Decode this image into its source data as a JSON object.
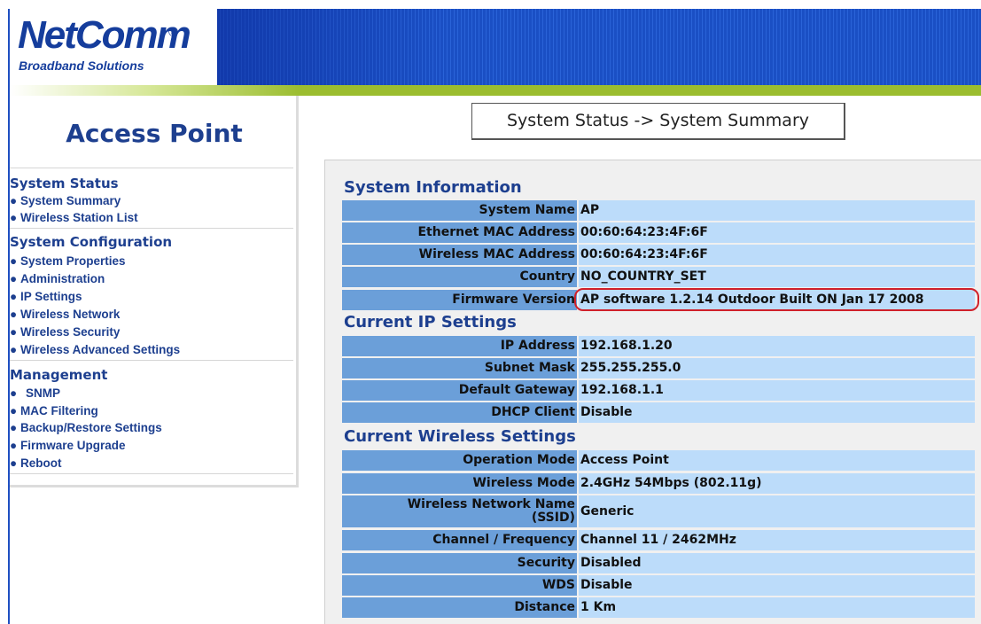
{
  "brand": {
    "logo": "NetComm",
    "registered": "®",
    "tagline": "Broadband Solutions"
  },
  "sidebar": {
    "title": "Access Point",
    "sections": [
      {
        "heading": "System Status",
        "items": [
          "System Summary",
          "Wireless Station List"
        ]
      },
      {
        "heading": "System Configuration",
        "items": [
          "System Properties",
          "Administration",
          "IP Settings",
          "Wireless Network",
          "Wireless Security",
          "Wireless Advanced Settings"
        ]
      },
      {
        "heading": "Management",
        "items": [
          "SNMP",
          "MAC Filtering",
          "Backup/Restore Settings",
          "Firmware Upgrade",
          "Reboot"
        ]
      }
    ],
    "bullet": "●"
  },
  "main": {
    "page_heading": "System Status -> System Summary",
    "system_information": {
      "title": "System Information",
      "rows": [
        {
          "label": "System Name",
          "value": "AP"
        },
        {
          "label": "Ethernet MAC Address",
          "value": "00:60:64:23:4F:6F"
        },
        {
          "label": "Wireless MAC Address",
          "value": "00:60:64:23:4F:6F"
        },
        {
          "label": "Country",
          "value": "NO_COUNTRY_SET"
        },
        {
          "label": "Firmware Version",
          "value": "AP software 1.2.14 Outdoor Built ON Jan 17 2008"
        }
      ]
    },
    "ip_settings": {
      "title": "Current IP Settings",
      "rows": [
        {
          "label": "IP Address",
          "value": "192.168.1.20"
        },
        {
          "label": "Subnet Mask",
          "value": "255.255.255.0"
        },
        {
          "label": "Default Gateway",
          "value": "192.168.1.1"
        },
        {
          "label": "DHCP Client",
          "value": "Disable"
        }
      ]
    },
    "wireless_settings": {
      "title": "Current Wireless Settings",
      "rows": [
        {
          "label": "Operation Mode",
          "value": "Access Point"
        },
        {
          "label": "Wireless Mode",
          "value": "2.4GHz 54Mbps (802.11g)"
        },
        {
          "label": "Wireless Network Name",
          "label2": "(SSID)",
          "value": "Generic"
        },
        {
          "label": "Channel / Frequency",
          "value": "Channel 11 / 2462MHz"
        },
        {
          "label": "Security",
          "value": "Disabled"
        },
        {
          "label": "WDS",
          "value": "Disable"
        },
        {
          "label": "Distance",
          "value": "1 Km"
        }
      ]
    }
  },
  "colors": {
    "brand_blue": "#153d9c",
    "banner_blue": "#1a4fc4",
    "green_bar": "#9bbd2f",
    "label_cell": "#6b9fd9",
    "value_cell": "#bcdcfa",
    "highlight_red": "#d0202a"
  }
}
